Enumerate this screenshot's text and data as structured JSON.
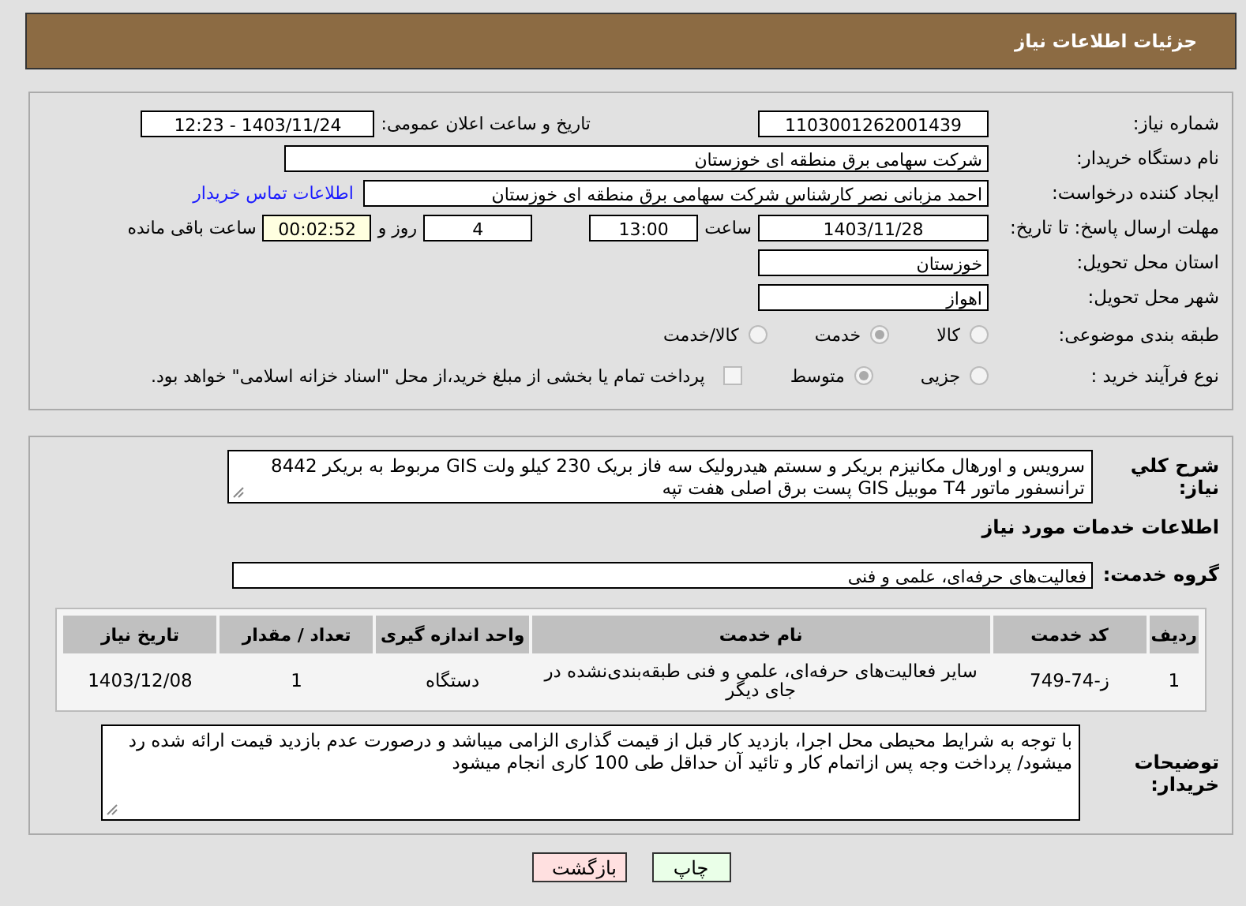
{
  "header": {
    "title": "جزئیات اطلاعات نیاز"
  },
  "details": {
    "need_number": {
      "label": "شماره نیاز:",
      "value": "1103001262001439"
    },
    "announce": {
      "label": "تاریخ و ساعت اعلان عمومی:",
      "value": "1403/11/24 - 12:23"
    },
    "buyer": {
      "label": "نام دستگاه خریدار:",
      "value": "شرکت سهامی برق منطقه ای خوزستان"
    },
    "creator": {
      "label": "ایجاد کننده درخواست:",
      "value": "احمد مزبانی نصر کارشناس شرکت سهامی برق منطقه ای خوزستان",
      "link": "اطلاعات تماس خریدار"
    },
    "deadline": {
      "label": "مهلت ارسال پاسخ: تا تاریخ:",
      "date": "1403/11/28",
      "time_label": "ساعت",
      "time": "13:00",
      "days": "4",
      "days_label": "روز و",
      "remaining": "00:02:52",
      "remaining_label": "ساعت باقی مانده"
    },
    "province": {
      "label": "استان محل تحویل:",
      "value": "خوزستان"
    },
    "city": {
      "label": "شهر محل تحویل:",
      "value": "اهواز"
    },
    "category": {
      "label": "طبقه بندی موضوعی:",
      "options": [
        {
          "label": "کالا",
          "selected": false
        },
        {
          "label": "خدمت",
          "selected": true
        },
        {
          "label": "کالا/خدمت",
          "selected": false
        }
      ]
    },
    "process": {
      "label": "نوع فرآیند خرید :",
      "options": [
        {
          "label": "جزیی",
          "selected": false
        },
        {
          "label": "متوسط",
          "selected": true
        }
      ],
      "treasury": {
        "checked": false,
        "text": "پرداخت تمام یا بخشی از مبلغ خرید،از محل \"اسناد خزانه اسلامی\" خواهد بود."
      }
    }
  },
  "services": {
    "description": {
      "label": "شرح کلي نياز:",
      "value": "سرویس و اورهال مکانیزم بریکر و سستم هیدرولیک سه فاز بریک 230 کیلو ولت GIS مربوط به بریکر 8442 ترانسفور ماتور T4  موبیل GIS پست برق اصلی هفت تپه"
    },
    "section_title": "اطلاعات خدمات مورد نیاز",
    "group": {
      "label": "گروه خدمت:",
      "value": "فعالیت‌های حرفه‌ای، علمی و فنی"
    },
    "table": {
      "columns": [
        "ردیف",
        "کد خدمت",
        "نام خدمت",
        "واحد اندازه گیری",
        "تعداد / مقدار",
        "تاریخ نیاز"
      ],
      "rows": [
        [
          "1",
          "ز-74-749",
          "سایر فعالیت‌های حرفه‌ای، علمی و فنی طبقه‌بندی‌نشده در جای دیگر",
          "دستگاه",
          "1",
          "1403/12/08"
        ]
      ]
    },
    "notes": {
      "label": "توضیحات خریدار:",
      "value": "با توجه به شرایط محیطی محل اجرا، بازدید کار قبل از قیمت گذاری الزامی میباشد و درصورت عدم بازدید قیمت ارائه شده رد میشود/ پرداخت وجه پس ازاتمام کار و تائید آن حداقل طی 100 کاری انجام میشود"
    }
  },
  "buttons": [
    {
      "label": "چاپ",
      "kind": "print"
    },
    {
      "label": "بازگشت",
      "kind": "back"
    }
  ]
}
